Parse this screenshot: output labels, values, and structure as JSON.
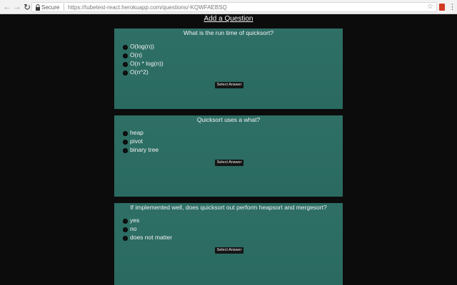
{
  "browser": {
    "secure_label": "Secure",
    "url": "https://tubetest-react.herokuapp.com/questions/-KQWFAEBSQ"
  },
  "page": {
    "add_question_label": "Add a Question"
  },
  "questions": [
    {
      "text": "What is the run time of quicksort?",
      "options": [
        "O(log(n))",
        "O(n)",
        "O(n * log(n))",
        "O(n^2)"
      ],
      "button_label": "Select Answer"
    },
    {
      "text": "Quicksort uses a what?",
      "options": [
        "heap",
        "pivot",
        "binary tree"
      ],
      "button_label": "Select Answer"
    },
    {
      "text": "If implemented well, does quicksort out perform heapsort and mergesort?",
      "options": [
        "yes",
        "no",
        "does not matter"
      ],
      "button_label": "Select Answer"
    }
  ],
  "colors": {
    "card_background": "#2e6f66",
    "page_background": "#0c0c0c",
    "button_background": "#151515"
  }
}
